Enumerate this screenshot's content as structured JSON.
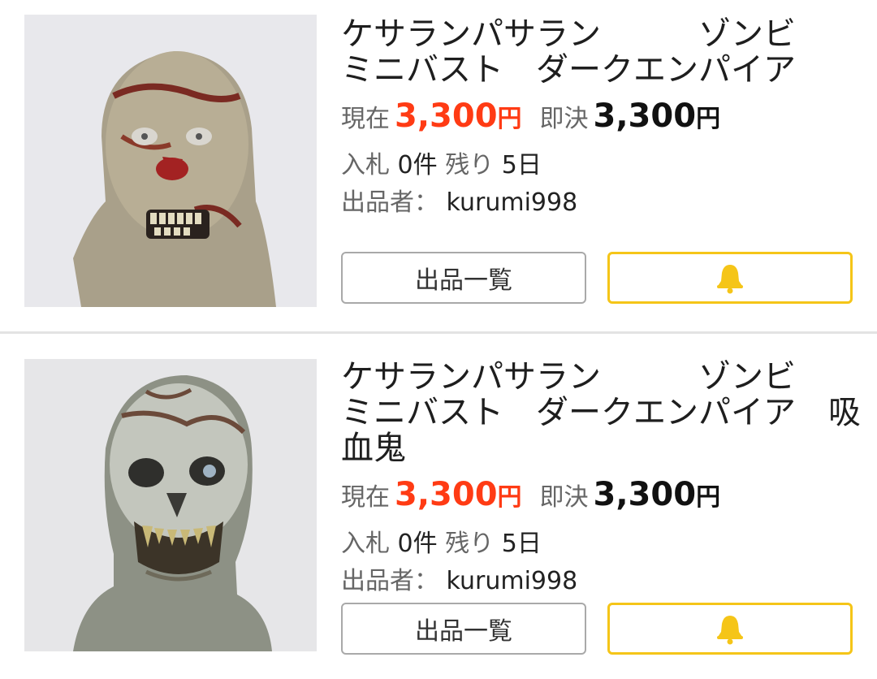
{
  "listings": [
    {
      "title": "ケサランパサラン　　　ゾンビ\nミニバスト　ダークエンパイア",
      "current_label": "現在",
      "current_price": "3,300",
      "current_yen": "円",
      "buyout_label": "即決",
      "buyout_price": "3,300",
      "buyout_yen": "円",
      "bids_label": "入札",
      "bids_value": "0件",
      "remaining_label": "残り",
      "remaining_value": "5日",
      "seller_label": "出品者：",
      "seller_value": "kurumi998",
      "list_button": "出品一覧",
      "watch_icon": "bell-icon"
    },
    {
      "title": "ケサランパサラン　　　ゾンビ\nミニバスト　ダークエンパイア　吸\n血鬼",
      "current_label": "現在",
      "current_price": "3,300",
      "current_yen": "円",
      "buyout_label": "即決",
      "buyout_price": "3,300",
      "buyout_yen": "円",
      "bids_label": "入札",
      "bids_value": "0件",
      "remaining_label": "残り",
      "remaining_value": "5日",
      "seller_label": "出品者：",
      "seller_value": "kurumi998",
      "list_button": "出品一覧",
      "watch_icon": "bell-icon"
    }
  ],
  "colors": {
    "price_accent": "#ff3b14",
    "watch_border": "#f5c518",
    "bell": "#f5c518"
  }
}
